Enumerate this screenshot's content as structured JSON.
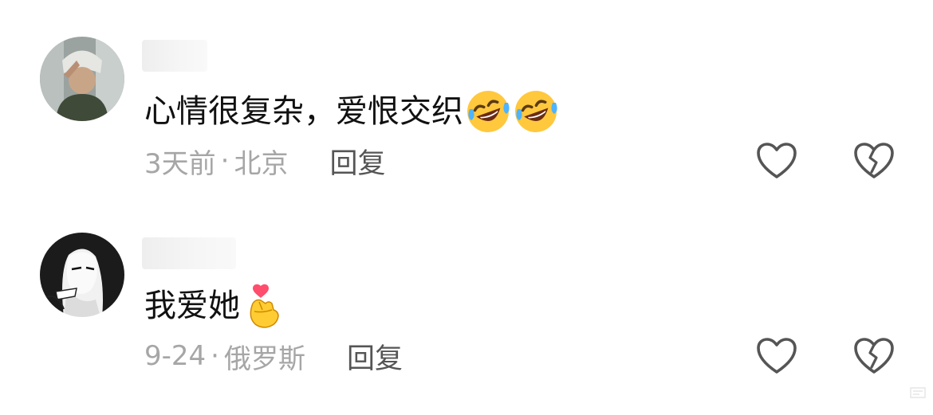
{
  "comments": [
    {
      "username": "",
      "avatar": "avatar-photo-icon",
      "text": "心情很复杂，爱恨交织",
      "emojis": [
        "rolling-on-floor-laughing-icon",
        "rolling-on-floor-laughing-icon"
      ],
      "time": "3天前",
      "separator": "·",
      "location": "北京",
      "reply_label": "回复"
    },
    {
      "username": "",
      "avatar": "avatar-manga-girl-icon",
      "text": "我爱她",
      "emojis": [
        "hand-with-index-finger-and-thumb-crossed-heart-icon"
      ],
      "time": "9-24",
      "separator": "·",
      "location": "俄罗斯",
      "reply_label": "回复"
    }
  ],
  "colors": {
    "text": "#111111",
    "meta": "#a6a6a6",
    "reply": "#555555",
    "icon_stroke": "#555555",
    "background": "#ffffff"
  }
}
